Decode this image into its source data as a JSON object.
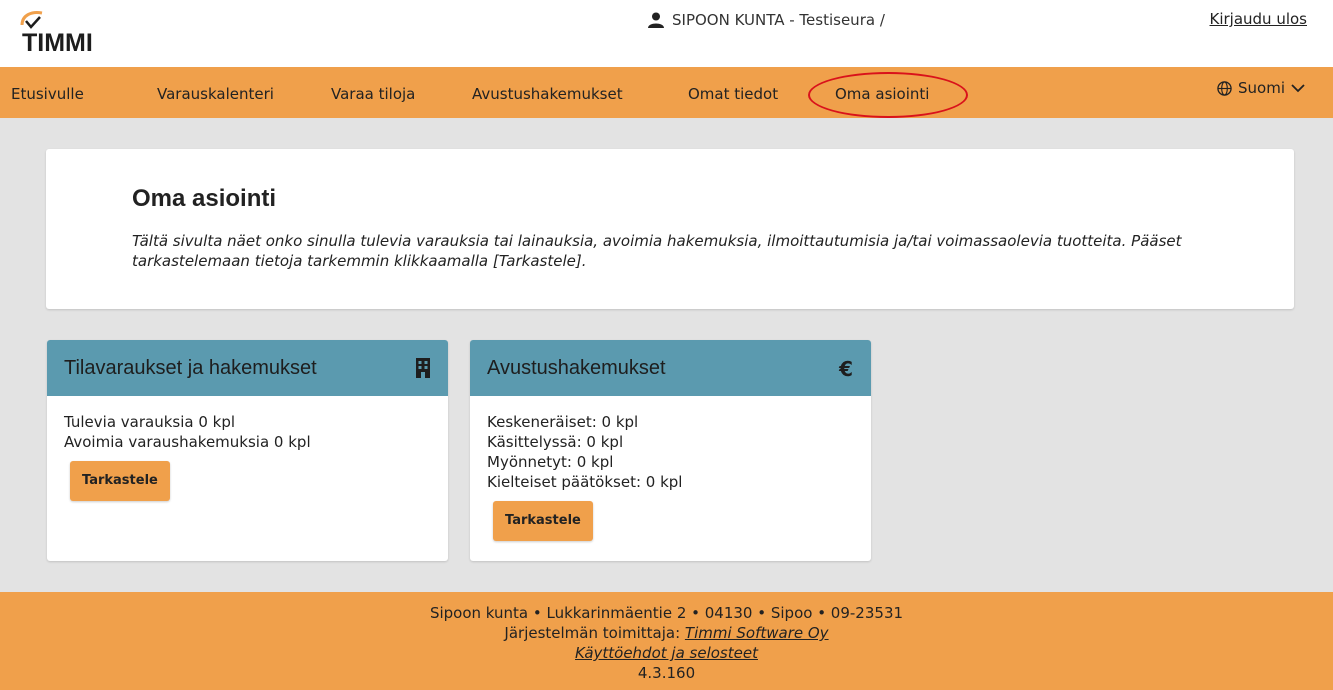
{
  "header": {
    "logo_text": "TIMMI",
    "user_label": "SIPOON KUNTA - Testiseura /",
    "logout_label": "Kirjaudu ulos"
  },
  "nav": {
    "items": [
      {
        "label": "Etusivulle"
      },
      {
        "label": "Varauskalenteri"
      },
      {
        "label": "Varaa tiloja"
      },
      {
        "label": "Avustushakemukset"
      },
      {
        "label": "Omat tiedot"
      },
      {
        "label": "Oma asiointi"
      }
    ],
    "language": "Suomi"
  },
  "intro": {
    "title": "Oma asiointi",
    "text": "Tältä sivulta näet onko sinulla tulevia varauksia tai lainauksia, avoimia hakemuksia, ilmoittautumisia ja/tai voimassaolevia tuotteita. Pääset tarkastelemaan tietoja tarkemmin klikkaamalla [Tarkastele]."
  },
  "cards": [
    {
      "title": "Tilavaraukset ja hakemukset",
      "icon": "building-icon",
      "lines": [
        "Tulevia varauksia 0 kpl",
        "Avoimia varaushakemuksia 0 kpl"
      ],
      "button": "Tarkastele"
    },
    {
      "title": "Avustushakemukset",
      "icon": "euro-icon",
      "icon_glyph": "€",
      "lines": [
        "Keskeneräiset: 0 kpl",
        "Käsittelyssä: 0 kpl",
        "Myönnetyt: 0 kpl",
        "Kielteiset päätökset: 0 kpl"
      ],
      "button": "Tarkastele"
    }
  ],
  "footer": {
    "address": "Sipoon kunta • Lukkarinmäentie 2 • 04130 • Sipoo • 09-23531",
    "provider_prefix": "Järjestelmän toimittaja: ",
    "provider_link": "Timmi Software Oy",
    "terms_link": "Käyttöehdot ja selosteet",
    "version": "4.3.160"
  },
  "colors": {
    "accent": "#f0a04b",
    "card_header": "#5b9aaf",
    "highlight": "#d9121b",
    "background": "#e3e3e3"
  }
}
